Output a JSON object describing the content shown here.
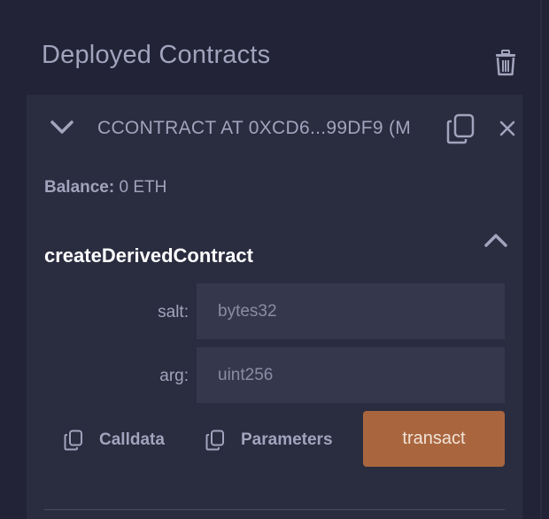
{
  "section": {
    "title": "Deployed Contracts"
  },
  "contract": {
    "name": "CCONTRACT AT 0XCD6...99DF9 (M",
    "balance_label": "Balance:",
    "balance_value": "0 ETH"
  },
  "function": {
    "name": "createDerivedContract",
    "params": [
      {
        "label": "salt:",
        "placeholder": "bytes32",
        "value": ""
      },
      {
        "label": "arg:",
        "placeholder": "uint256",
        "value": ""
      }
    ],
    "calldata_label": "Calldata",
    "parameters_label": "Parameters",
    "transact_label": "transact"
  },
  "colors": {
    "background": "#222336",
    "card": "#2a2c3f",
    "input": "#35384c",
    "text": "#a2a3bd",
    "accent": "#a9663e"
  },
  "icons": {
    "trash": "trash-icon",
    "collapse": "chevron-down-icon",
    "copy": "copy-icon",
    "close": "close-icon",
    "expand": "chevron-up-icon"
  }
}
